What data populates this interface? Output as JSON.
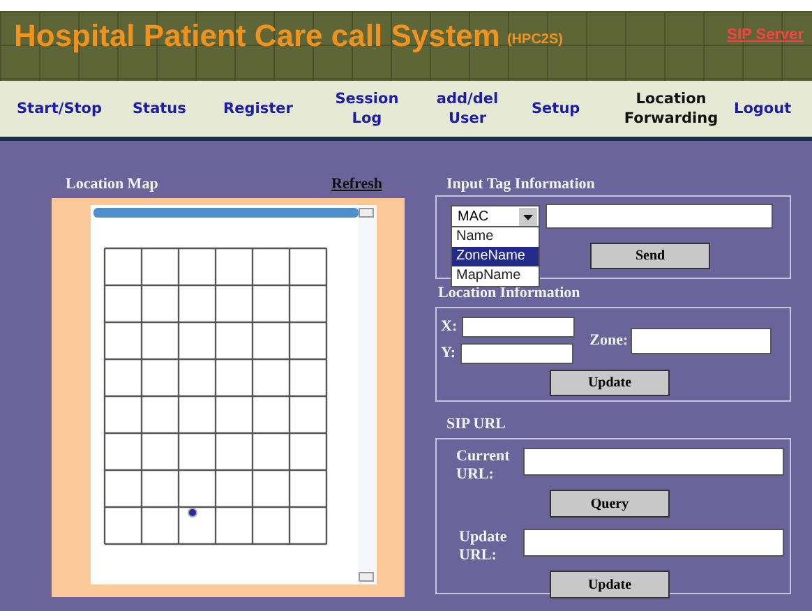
{
  "header": {
    "title": "Hospital Patient Care call System",
    "subtitle": "(HPC2S)",
    "link": "SIP Server"
  },
  "nav": [
    {
      "label": "Start/Stop",
      "selected": false
    },
    {
      "label": "Status",
      "selected": false
    },
    {
      "label": "Register",
      "selected": false
    },
    {
      "label": "Session Log",
      "selected": false
    },
    {
      "label": "add/del User",
      "selected": false
    },
    {
      "label": "Setup",
      "selected": false
    },
    {
      "label": "Location Forwarding",
      "selected": true
    },
    {
      "label": "Logout",
      "selected": false
    }
  ],
  "map": {
    "title": "Location Map",
    "refresh": "Refresh"
  },
  "input_tag": {
    "title": "Input Tag Information",
    "select_value": "MAC",
    "options": [
      {
        "label": "Name",
        "selected": false
      },
      {
        "label": "ZoneName",
        "selected": true
      },
      {
        "label": "MapName",
        "selected": false
      }
    ],
    "button": "Send"
  },
  "location": {
    "title": "Location Information",
    "x_label": "X:",
    "y_label": "Y:",
    "zone_label": "Zone:",
    "button": "Update"
  },
  "sip_url": {
    "title": "SIP URL",
    "current_label": "Current URL:",
    "query_button": "Query",
    "update_label": "Update URL:",
    "update_button": "Update"
  }
}
